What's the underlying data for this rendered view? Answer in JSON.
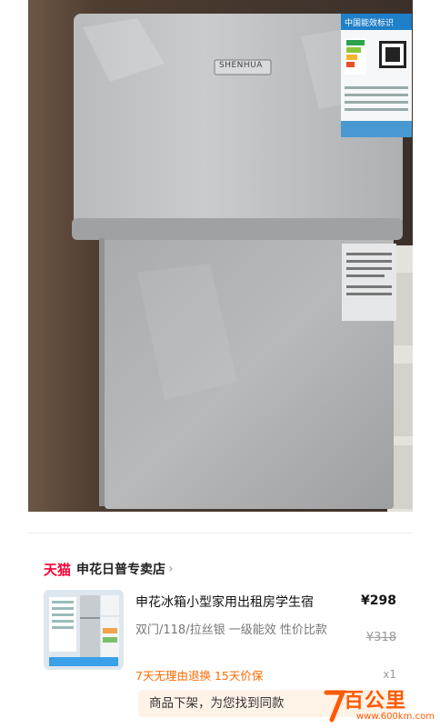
{
  "photo": {
    "brand_plate": "SHENHUA",
    "energy_label_title": "中国能效标识"
  },
  "shop": {
    "platform": "天猫",
    "name": "申花日普专卖店",
    "chevron_icon": "chevron-right-icon"
  },
  "product": {
    "title": "申花冰箱小型家用出租房学生宿",
    "specs": "双门/118/拉丝银 一级能效 性价比款",
    "price": "¥298",
    "original_price": "¥318",
    "services": "7天无理由退换  15天价保",
    "quantity": "x1"
  },
  "notice": {
    "text": "商品下架，为您找到同款"
  },
  "watermark": {
    "brand": "百公里",
    "url": "www.600km.com"
  },
  "colors": {
    "tmall_red": "#ff0036",
    "service_orange": "#ff6a00",
    "notice_bg": "#fff3e8"
  }
}
